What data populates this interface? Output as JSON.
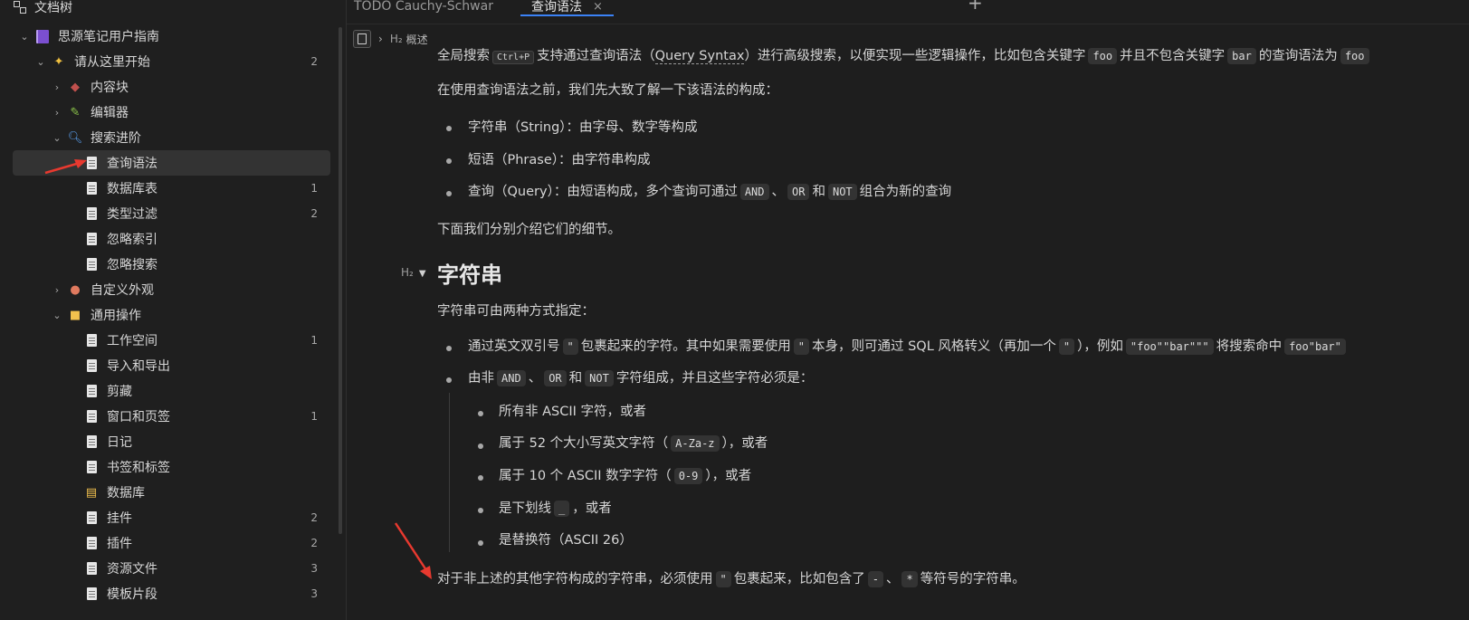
{
  "sidebar": {
    "title": "文档树",
    "items": [
      {
        "label": "思源笔记用户指南",
        "count": "",
        "icon": "notebook-icon"
      },
      {
        "label": "请从这里开始",
        "count": "2",
        "icon": "party-icon"
      },
      {
        "label": "内容块",
        "count": "",
        "icon": "block-icon"
      },
      {
        "label": "编辑器",
        "count": "",
        "icon": "editor-icon"
      },
      {
        "label": "搜索进阶",
        "count": "",
        "icon": "search-icon"
      },
      {
        "label": "查询语法",
        "count": "",
        "icon": "doc-icon"
      },
      {
        "label": "数据库表",
        "count": "1",
        "icon": "doc-icon"
      },
      {
        "label": "类型过滤",
        "count": "2",
        "icon": "doc-icon"
      },
      {
        "label": "忽略索引",
        "count": "",
        "icon": "doc-icon"
      },
      {
        "label": "忽略搜索",
        "count": "",
        "icon": "doc-icon"
      },
      {
        "label": "自定义外观",
        "count": "",
        "icon": "palette-icon"
      },
      {
        "label": "通用操作",
        "count": "",
        "icon": "bus-icon"
      },
      {
        "label": "工作空间",
        "count": "1",
        "icon": "doc-icon"
      },
      {
        "label": "导入和导出",
        "count": "",
        "icon": "doc-icon"
      },
      {
        "label": "剪藏",
        "count": "",
        "icon": "doc-icon"
      },
      {
        "label": "窗口和页签",
        "count": "1",
        "icon": "doc-icon"
      },
      {
        "label": "日记",
        "count": "",
        "icon": "doc-icon"
      },
      {
        "label": "书签和标签",
        "count": "",
        "icon": "doc-icon"
      },
      {
        "label": "数据库",
        "count": "",
        "icon": "database-icon"
      },
      {
        "label": "挂件",
        "count": "2",
        "icon": "doc-icon"
      },
      {
        "label": "插件",
        "count": "2",
        "icon": "doc-icon"
      },
      {
        "label": "资源文件",
        "count": "3",
        "icon": "doc-icon"
      },
      {
        "label": "模板片段",
        "count": "3",
        "icon": "doc-icon"
      }
    ]
  },
  "tabs": [
    {
      "label": "TODO Cauchy-Schwar"
    },
    {
      "label": "查询语法",
      "close": "×"
    }
  ],
  "tab_add": "+",
  "breadcrumb": {
    "h2": "H₂",
    "label": "概述"
  },
  "content": {
    "p1": {
      "a": "全局搜索",
      "kbd": "Ctrl+P",
      "b": "支持通过查询语法（",
      "c": "Query Syntax",
      "d": "）进行高级搜索，以便实现一些逻辑操作，比如包含关键字",
      "code1": "foo",
      "e": "并且不包含关键字",
      "code2": "bar",
      "f": "的查询语法为",
      "code3": "foo"
    },
    "p2": "在使用查询语法之前，我们先大致了解一下该语法的构成：",
    "list1": [
      "字符串（String）：由字母、数字等构成",
      "短语（Phrase）：由字符串构成"
    ],
    "list1_q": {
      "a": "查询（Query）：由短语构成，多个查询可通过",
      "and": "AND",
      "sep": "、",
      "or": "OR",
      "he": "和",
      "not": "NOT",
      "b": "组合为新的查询"
    },
    "p3": "下面我们分别介绍它们的细节。",
    "h2_marker": "H₂",
    "h2": "字符串",
    "p4": "字符串可由两种方式指定：",
    "b1": {
      "a": "通过英文双引号",
      "q1": "\"",
      "b": "包裹起来的字符。其中如果需要使用",
      "q2": "\"",
      "c": "本身，则可通过 SQL 风格转义（再加一个",
      "q3": "\"",
      "d": "），例如",
      "ex1": "\"foo\"\"bar\"\"\"",
      "e": "将搜索命中",
      "ex2": "foo\"bar\""
    },
    "b2": {
      "a": "由非",
      "and": "AND",
      "sep": "、",
      "or": "OR",
      "he": "和",
      "not": "NOT",
      "b": "字符组成，并且这些字符必须是："
    },
    "sub": {
      "s1": "所有非 ASCII 字符，或者",
      "s2a": "属于 52 个大小写英文字符（",
      "s2code": "A-Za-z",
      "s2b": "），或者",
      "s3a": "属于 10 个 ASCII 数字字符（",
      "s3code": "0-9",
      "s3b": "），或者",
      "s4a": "是下划线",
      "s4code": "_",
      "s4b": "，或者",
      "s5": "是替换符（ASCII 26）"
    },
    "p5": {
      "a": "对于非上述的其他字符构成的字符串，必须使用",
      "q": "\"",
      "b": "包裹起来，比如包含了",
      "c1": "-",
      "sep": "、",
      "c2": "*",
      "c": "等符号的字符串。"
    }
  },
  "colors": {
    "accent": "#3b82f6",
    "annotation_arrow": "#e8392f"
  }
}
